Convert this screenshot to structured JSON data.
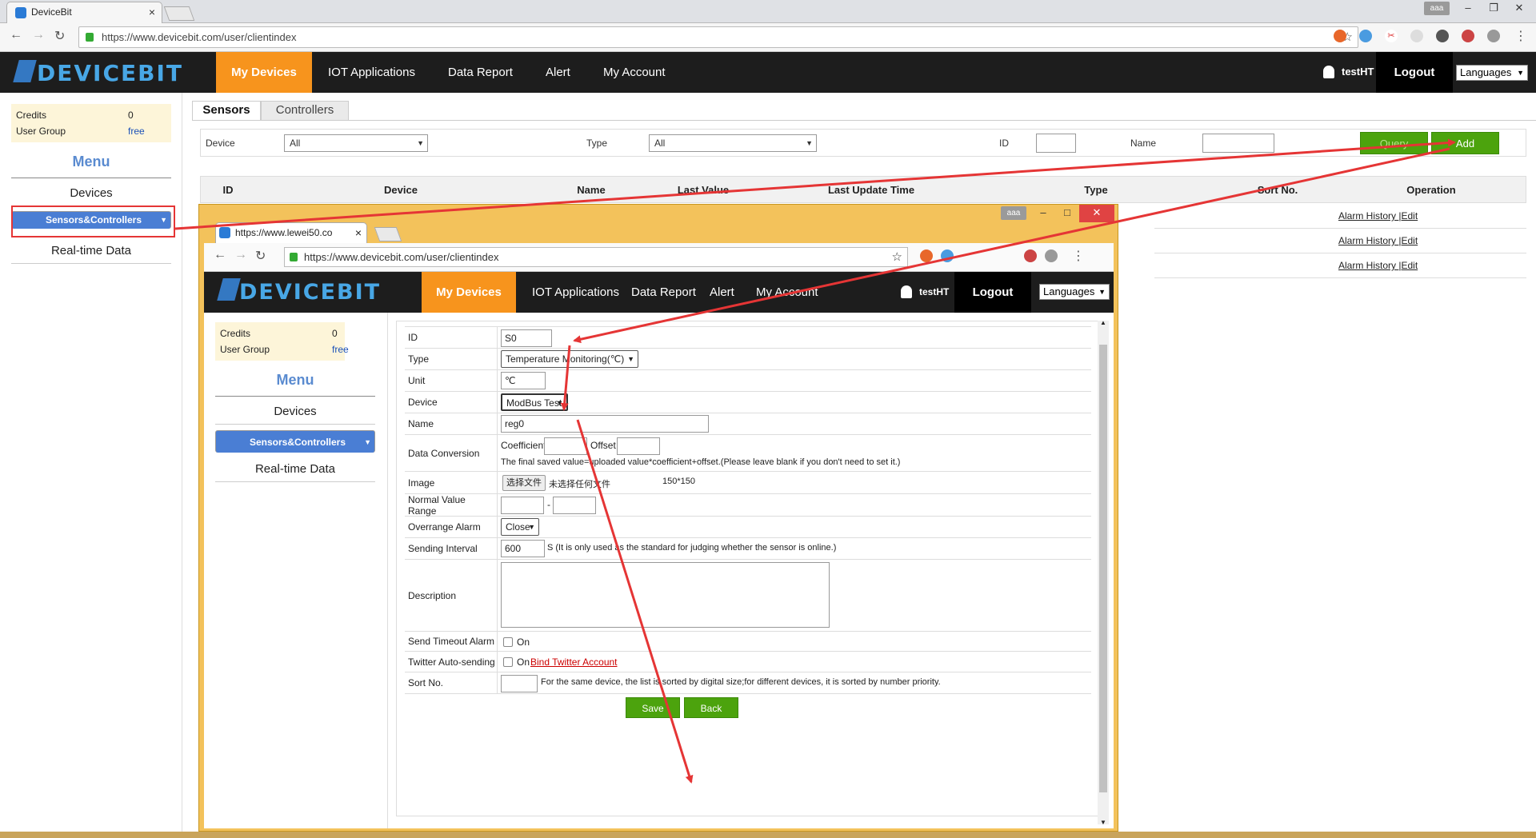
{
  "browser": {
    "tab_title": "DeviceBit",
    "url": "https://www.devicebit.com/user/clientindex",
    "user_chip": "aaa"
  },
  "site": {
    "logo": "DEVICEBIT",
    "nav": [
      "My Devices",
      "IOT Applications",
      "Data Report",
      "Alert",
      "My Account"
    ],
    "username": "testHT",
    "logout": "Logout",
    "languages": "Languages"
  },
  "left": {
    "credits_label": "Credits",
    "credits_value": "0",
    "group_label": "User Group",
    "group_value": "free",
    "menu_title": "Menu",
    "items": [
      "Devices",
      "Sensors&Controllers",
      "Real-time Data"
    ]
  },
  "content": {
    "tabs": [
      "Sensors",
      "Controllers"
    ],
    "filter": {
      "device_label": "Device",
      "device_value": "All",
      "type_label": "Type",
      "type_value": "All",
      "id_label": "ID",
      "name_label": "Name",
      "query_button": "Query",
      "add_button": "Add"
    },
    "columns": [
      "ID",
      "Device",
      "Name",
      "Last Value",
      "Last Update Time",
      "Type",
      "Sort No.",
      "Operation"
    ],
    "row_operation_alarm": "Alarm History",
    "row_operation_edit": "|Edit"
  },
  "popup": {
    "tab_title": "https://www.lewei50.co",
    "url": "https://www.devicebit.com/user/clientindex",
    "user_chip": "aaa",
    "form": {
      "id_label": "ID",
      "id_value": "S0",
      "type_label": "Type",
      "type_value": "Temperature Monitoring(℃)",
      "unit_label": "Unit",
      "unit_value": "℃",
      "device_label": "Device",
      "device_value": "ModBus Test",
      "name_label": "Name",
      "name_value": "reg0",
      "conversion_label": "Data Conversion",
      "coefficient_label": "Coefficient:",
      "offset_label": "Offset :",
      "conversion_note": "The final saved value=uploaded value*coefficient+offset.(Please leave blank if you don't need to set it.)",
      "image_label": "Image",
      "file_button": "选择文件",
      "file_status": "未选择任何文件",
      "image_size": "150*150",
      "range_label": "Normal Value Range",
      "range_sep": "-",
      "overrange_label": "Overrange Alarm",
      "overrange_value": "Close",
      "interval_label": "Sending Interval",
      "interval_value": "600",
      "interval_note": "S (It is only used as the standard for judging whether the sensor is online.)",
      "description_label": "Description",
      "timeout_label": "Send Timeout Alarm",
      "timeout_option": "On",
      "twitter_label": "Twitter Auto-sending",
      "twitter_option": "On",
      "twitter_link": "Bind Twitter Account",
      "sort_label": "Sort No.",
      "sort_note": "For the same device, the list is sorted by digital size;for different devices, it is sorted by number priority.",
      "save_button": "Save",
      "back_button": "Back"
    }
  },
  "colors": {
    "accent_orange": "#f7941d",
    "header_black": "#1d1d1d",
    "menu_blue": "#4a7ed4",
    "button_green": "#4ca30d",
    "annotation_red": "#e53535",
    "popup_frame": "#f3c25b"
  }
}
